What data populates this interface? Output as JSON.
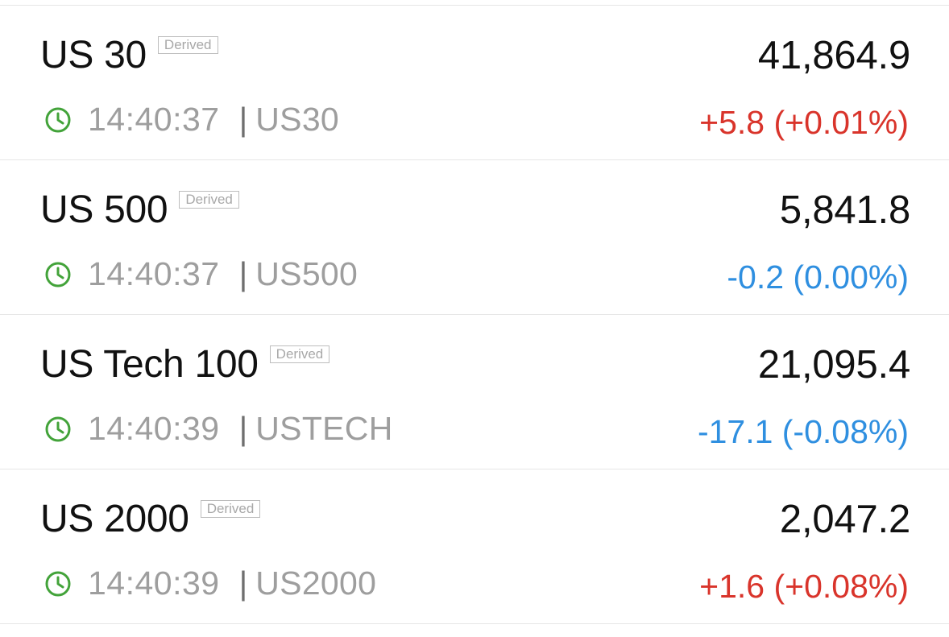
{
  "colors": {
    "positive": "#d9342b",
    "negative": "#2f8fe0",
    "clock": "#43a33a"
  },
  "instruments": [
    {
      "name": "US 30",
      "badge": "Derived",
      "price": "41,864.9",
      "time": "14:40:37",
      "separator": "|",
      "symbol": "US30",
      "change": "+5.8 (+0.01%)",
      "direction": "positive"
    },
    {
      "name": "US 500",
      "badge": "Derived",
      "price": "5,841.8",
      "time": "14:40:37",
      "separator": "|",
      "symbol": "US500",
      "change": "-0.2 (0.00%)",
      "direction": "negative"
    },
    {
      "name": "US Tech 100",
      "badge": "Derived",
      "price": "21,095.4",
      "time": "14:40:39",
      "separator": "|",
      "symbol": "USTECH",
      "change": "-17.1 (-0.08%)",
      "direction": "negative"
    },
    {
      "name": "US 2000",
      "badge": "Derived",
      "price": "2,047.2",
      "time": "14:40:39",
      "separator": "|",
      "symbol": "US2000",
      "change": "+1.6 (+0.08%)",
      "direction": "positive"
    }
  ]
}
